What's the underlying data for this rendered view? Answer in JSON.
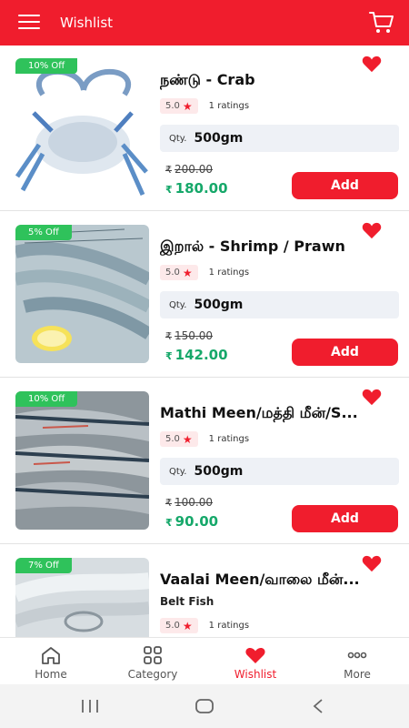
{
  "header": {
    "title": "Wishlist"
  },
  "products": [
    {
      "name": "நண்டு - Crab",
      "subname": "",
      "discount": "10% Off",
      "rating": "5.0",
      "ratings_text": "1 ratings",
      "qty_label": "Qty.",
      "qty": "500gm",
      "old_price": "200.00",
      "price": "180.00",
      "add_label": "Add"
    },
    {
      "name": "இறால் - Shrimp / Prawn",
      "subname": "",
      "discount": "5% Off",
      "rating": "5.0",
      "ratings_text": "1 ratings",
      "qty_label": "Qty.",
      "qty": "500gm",
      "old_price": "150.00",
      "price": "142.00",
      "add_label": "Add"
    },
    {
      "name": "Mathi Meen/மத்தி மீன்/S...",
      "subname": "",
      "discount": "10% Off",
      "rating": "5.0",
      "ratings_text": "1 ratings",
      "qty_label": "Qty.",
      "qty": "500gm",
      "old_price": "100.00",
      "price": "90.00",
      "add_label": "Add"
    },
    {
      "name": "Vaalai Meen/வாலை மீன்...",
      "subname": "Belt Fish",
      "discount": "7% Off",
      "rating": "5.0",
      "ratings_text": "1 ratings"
    }
  ],
  "currency_symbol": "₹",
  "bottom_nav": [
    {
      "label": "Home",
      "icon": "home-icon"
    },
    {
      "label": "Category",
      "icon": "grid-icon"
    },
    {
      "label": "Wishlist",
      "icon": "heart-icon",
      "active": true
    },
    {
      "label": "More",
      "icon": "more-icon"
    }
  ],
  "colors": {
    "primary": "#f01d2d",
    "price_green": "#16a86a",
    "discount_green": "#2fc25b"
  }
}
